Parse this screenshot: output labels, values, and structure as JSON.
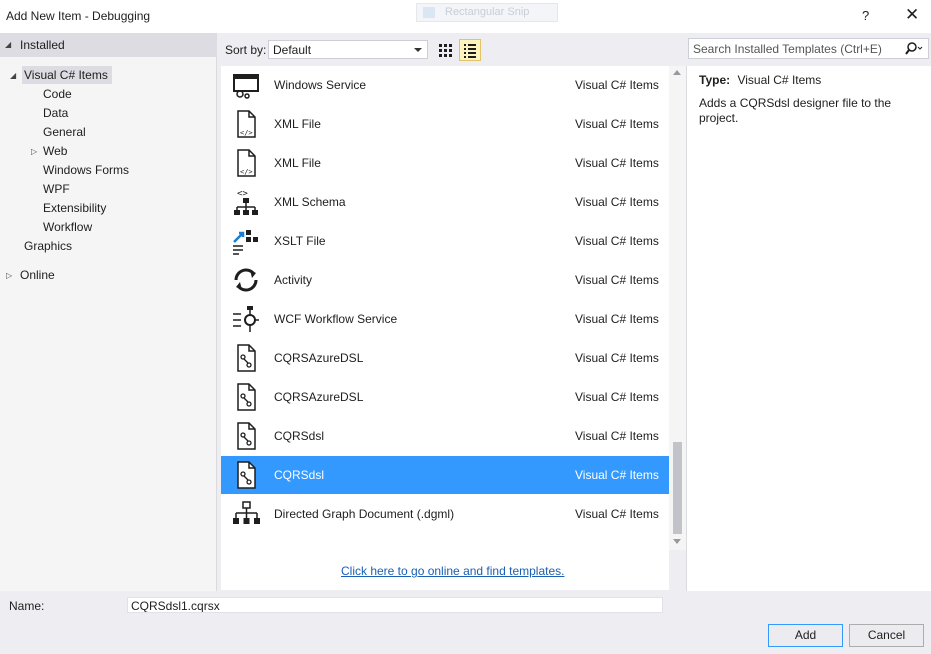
{
  "window": {
    "title": "Add New Item - Debugging",
    "ghost_tab": "Rectangular Snip",
    "help": "?",
    "close": "✕"
  },
  "tree": {
    "installed": "Installed",
    "visual_csharp": "Visual C# Items",
    "children": [
      "Code",
      "Data",
      "General",
      "Web",
      "Windows Forms",
      "WPF",
      "Extensibility",
      "Workflow"
    ],
    "graphics": "Graphics",
    "online": "Online"
  },
  "toolbar": {
    "sort_label": "Sort by:",
    "sort_value": "Default"
  },
  "items": [
    {
      "name": "Windows Service",
      "category": "Visual C# Items",
      "icon": "windows-service-icon"
    },
    {
      "name": "XML File",
      "category": "Visual C# Items",
      "icon": "xml-file-icon"
    },
    {
      "name": "XML File",
      "category": "Visual C# Items",
      "icon": "xml-file-icon"
    },
    {
      "name": "XML Schema",
      "category": "Visual C# Items",
      "icon": "xml-schema-icon"
    },
    {
      "name": "XSLT File",
      "category": "Visual C# Items",
      "icon": "xslt-file-icon"
    },
    {
      "name": "Activity",
      "category": "Visual C# Items",
      "icon": "activity-icon"
    },
    {
      "name": "WCF Workflow Service",
      "category": "Visual C# Items",
      "icon": "wcf-workflow-icon"
    },
    {
      "name": "CQRSAzureDSL",
      "category": "Visual C# Items",
      "icon": "dsl-file-icon"
    },
    {
      "name": "CQRSAzureDSL",
      "category": "Visual C# Items",
      "icon": "dsl-file-icon"
    },
    {
      "name": "CQRSdsl",
      "category": "Visual C# Items",
      "icon": "dsl-file-icon"
    },
    {
      "name": "CQRSdsl",
      "category": "Visual C# Items",
      "icon": "dsl-file-icon",
      "selected": true
    },
    {
      "name": "Directed Graph Document (.dgml)",
      "category": "Visual C# Items",
      "icon": "dgml-icon"
    }
  ],
  "online_link": "Click here to go online and find templates.",
  "search": {
    "placeholder": "Search Installed Templates (Ctrl+E)"
  },
  "details": {
    "type_label": "Type:",
    "type_value": "Visual C# Items",
    "description": "Adds a CQRSdsl designer file to the project."
  },
  "footer": {
    "name_label": "Name:",
    "name_value": "CQRSdsl1.cqrsx",
    "add_label": "Add",
    "cancel_label": "Cancel"
  },
  "colors": {
    "selection": "#3399ff",
    "link": "#1a5fb4"
  }
}
